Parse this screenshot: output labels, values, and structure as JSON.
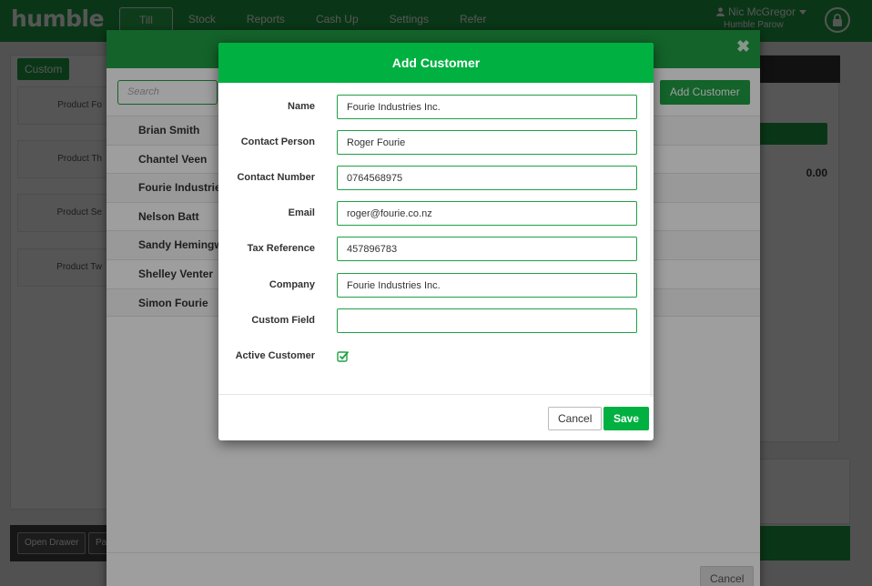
{
  "app": {
    "logo": "humble",
    "nav_tabs": [
      {
        "label": "Till"
      },
      {
        "label": "Stock"
      },
      {
        "label": "Reports"
      },
      {
        "label": "Cash Up"
      },
      {
        "label": "Settings"
      },
      {
        "label": "Refer"
      }
    ],
    "user_name": "Nic McGregor",
    "store_name": "Humble Parow"
  },
  "left_panel": {
    "custom_label": "Custom",
    "products": [
      "Product Fo",
      "Product Th",
      "Product Se",
      "Product Tw"
    ],
    "bottom_buttons": [
      "Open Drawer",
      "Pay"
    ]
  },
  "right_panel": {
    "total": "0.00"
  },
  "customer_modal": {
    "search_placeholder": "Search",
    "add_button_label": "Add Customer",
    "customers": [
      "Brian Smith",
      "Chantel Veen",
      "Fourie Industries",
      "Nelson Batt",
      "Sandy Hemingway",
      "Shelley Venter",
      "Simon Fourie"
    ],
    "cancel_label": "Cancel"
  },
  "add_customer": {
    "title": "Add Customer",
    "fields": [
      {
        "label": "Name",
        "value": "Fourie Industries Inc."
      },
      {
        "label": "Contact Person",
        "value": "Roger Fourie"
      },
      {
        "label": "Contact Number",
        "value": "0764568975"
      },
      {
        "label": "Email",
        "value": "roger@fourie.co.nz"
      },
      {
        "label": "Tax Reference",
        "value": "457896783"
      },
      {
        "label": "Company",
        "value": "Fourie Industries Inc."
      },
      {
        "label": "Custom Field",
        "value": ""
      }
    ],
    "active_label": "Active Customer",
    "active_checked": true,
    "cancel_label": "Cancel",
    "save_label": "Save"
  },
  "colors": {
    "brand_green": "#1fa045",
    "modal_header_green": "#00b040"
  }
}
